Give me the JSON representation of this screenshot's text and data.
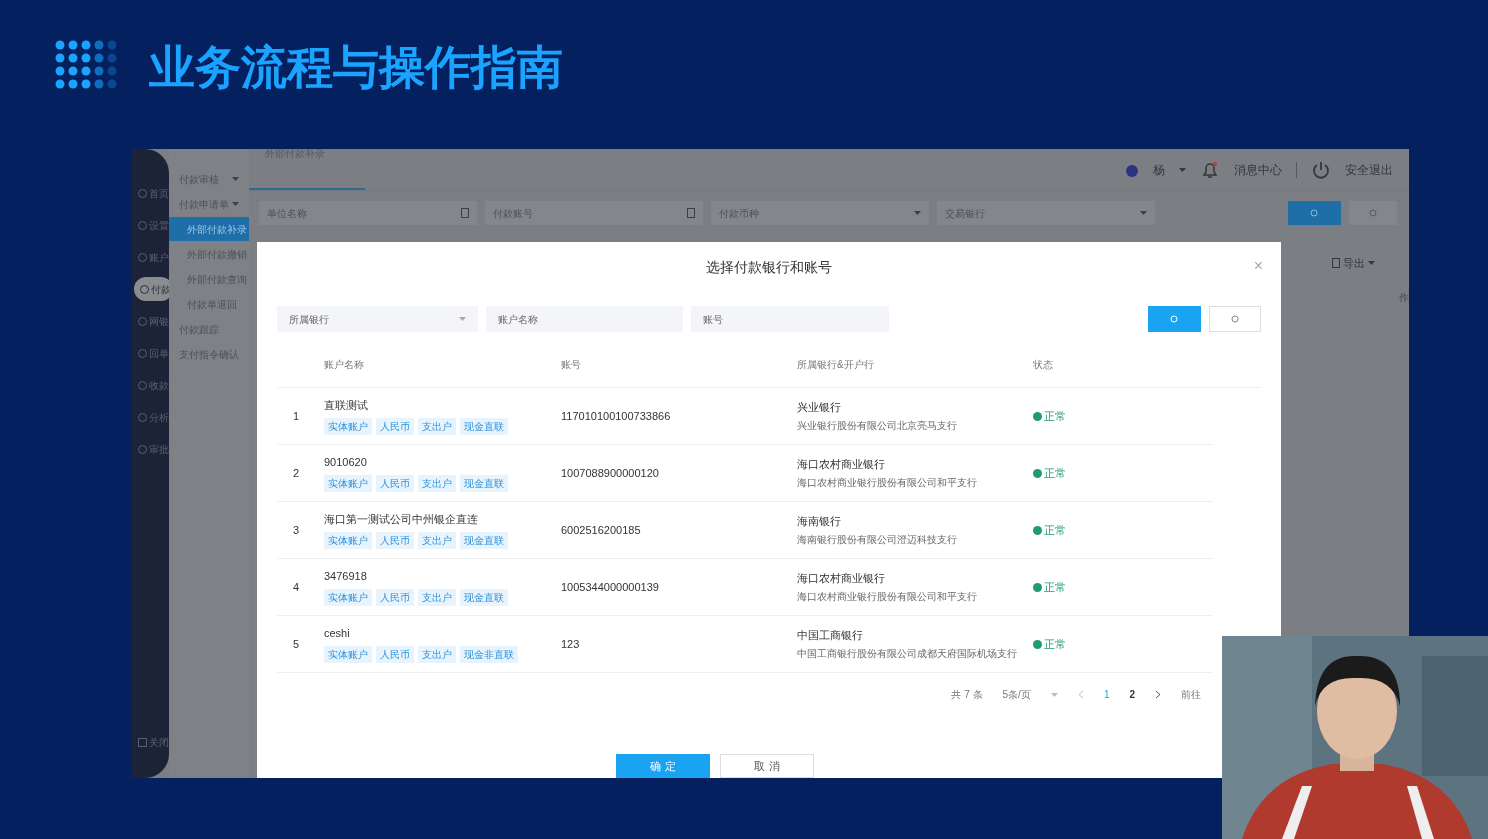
{
  "slide": {
    "title": "业务流程与操作指南"
  },
  "app": {
    "rail": [
      {
        "label": "首页",
        "selected": false
      },
      {
        "label": "设置",
        "selected": false
      },
      {
        "label": "账户",
        "selected": false
      },
      {
        "label": "付款",
        "selected": true
      },
      {
        "label": "网银",
        "selected": false
      },
      {
        "label": "回单",
        "selected": false
      },
      {
        "label": "收款",
        "selected": false
      },
      {
        "label": "分析",
        "selected": false
      },
      {
        "label": "审批",
        "selected": false
      }
    ],
    "rail_bottom": "关闭",
    "submenu": [
      {
        "label": "付款审核",
        "kind": "group",
        "selected": false
      },
      {
        "label": "付款申请单",
        "kind": "group",
        "selected": false
      },
      {
        "label": "外部付款补录",
        "kind": "item",
        "selected": true
      },
      {
        "label": "外部付款撤销",
        "kind": "item",
        "selected": false
      },
      {
        "label": "外部付款查询",
        "kind": "item",
        "selected": false
      },
      {
        "label": "付款单退回",
        "kind": "item",
        "selected": false
      },
      {
        "label": "付款跟踪",
        "kind": "group",
        "selected": false
      },
      {
        "label": "支付指令确认",
        "kind": "group",
        "selected": false
      }
    ],
    "tab": "外部付款补录",
    "user": "杨",
    "messages": "消息中心",
    "logout": "安全退出",
    "filters": [
      {
        "placeholder": "单位名称",
        "kind": "input"
      },
      {
        "placeholder": "付款账号",
        "kind": "input"
      },
      {
        "placeholder": "付款币种",
        "kind": "select"
      },
      {
        "placeholder": "交易银行",
        "kind": "select"
      }
    ],
    "export": "导出",
    "column_cut": "作"
  },
  "dialog": {
    "title": "选择付款银行和账号",
    "close": "×",
    "filters": [
      {
        "placeholder": "所属银行",
        "kind": "select"
      },
      {
        "placeholder": "账户名称",
        "kind": "input"
      },
      {
        "placeholder": "账号",
        "kind": "input"
      }
    ],
    "columns": [
      "账户名称",
      "账号",
      "所属银行&开户行",
      "状态"
    ],
    "rows": [
      {
        "index": "1",
        "name": "直联测试",
        "tags": [
          "实体账户",
          "人民币",
          "支出户",
          "现金直联"
        ],
        "account": "117010100100733866",
        "bank": "兴业银行",
        "branch": "兴业银行股份有限公司北京亮马支行",
        "status": "正常",
        "color": "#1f9d6b"
      },
      {
        "index": "2",
        "name": "9010620",
        "tags": [
          "实体账户",
          "人民币",
          "支出户",
          "现金直联"
        ],
        "account": "1007088900000120",
        "bank": "海口农村商业银行",
        "branch": "海口农村商业银行股份有限公司和平支行",
        "status": "正常",
        "color": "#1f9d6b"
      },
      {
        "index": "3",
        "name": "海口第一测试公司中州银企直连",
        "tags": [
          "实体账户",
          "人民币",
          "支出户",
          "现金直联"
        ],
        "account": "6002516200185",
        "bank": "海南银行",
        "branch": "海南银行股份有限公司澄迈科技支行",
        "status": "正常",
        "color": "#1f9d6b"
      },
      {
        "index": "4",
        "name": "3476918",
        "tags": [
          "实体账户",
          "人民币",
          "支出户",
          "现金直联"
        ],
        "account": "1005344000000139",
        "bank": "海口农村商业银行",
        "branch": "海口农村商业银行股份有限公司和平支行",
        "status": "正常",
        "color": "#1f9d6b"
      },
      {
        "index": "5",
        "name": "ceshi",
        "tags": [
          "实体账户",
          "人民币",
          "支出户",
          "现金非直联"
        ],
        "account": "123",
        "bank": "中国工商银行",
        "branch": "中国工商银行股份有限公司成都天府国际机场支行",
        "status": "正常",
        "color": "#1f9d6b"
      }
    ],
    "pagination": {
      "total": "共 7 条",
      "page_size": "5条/页",
      "pages": [
        {
          "label": "1",
          "selected": true
        },
        {
          "label": "2",
          "selected": false
        }
      ],
      "goto": "前往"
    },
    "buttons": [
      {
        "label": "确 定",
        "kind": "primary"
      },
      {
        "label": "取 消",
        "kind": "default"
      }
    ]
  }
}
